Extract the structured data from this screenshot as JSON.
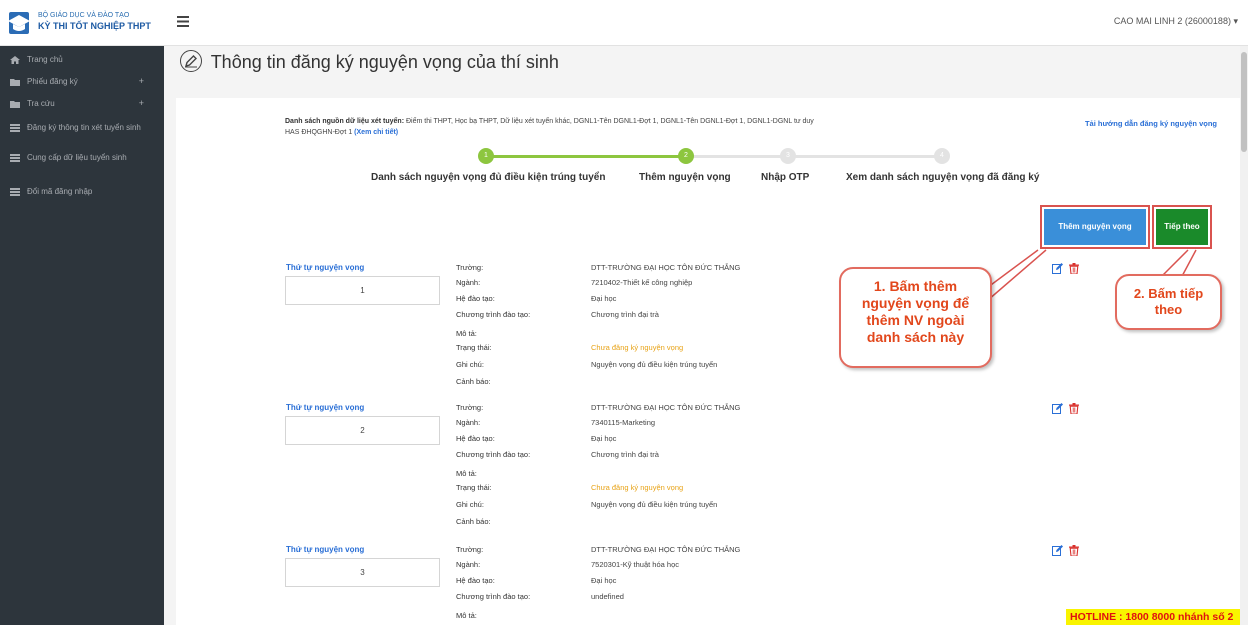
{
  "logo": {
    "line1": "BỘ GIÁO DỤC VÀ ĐÀO TẠO",
    "line2": "KỲ THI TỐT NGHIỆP THPT"
  },
  "sidebar": {
    "items": [
      {
        "label": "Trang chủ",
        "icon": "home-icon"
      },
      {
        "label": "Phiếu đăng ký",
        "icon": "folder-icon",
        "plus": "+"
      },
      {
        "label": "Tra cứu",
        "icon": "folder-icon",
        "plus": "+"
      },
      {
        "label": "Đăng ký thông tin xét tuyển sinh",
        "icon": "list-icon"
      },
      {
        "label": "Cung cấp dữ liệu tuyển sinh",
        "icon": "list-icon"
      },
      {
        "label": "Đổi mã đăng nhập",
        "icon": "list-icon"
      }
    ]
  },
  "topbar": {
    "user": "CAO MAI LINH 2 (26000188)",
    "user_caret": "▾"
  },
  "page": {
    "title": "Thông tin đăng ký nguyện vọng của thí sinh"
  },
  "sources": {
    "label": "Danh sách nguồn dữ liệu xét tuyển:",
    "text": " Điểm thi THPT, Học bạ THPT, Dữ liệu xét tuyển khác, DGNL1-Tên DGNL1-Đợt 1, DGNL1-Tên DGNL1-Đợt 1, DGNL1-DGNL tư duy HAS ĐHQGHN-Đợt 1",
    "link": "(Xem chi tiết)"
  },
  "guide_link": "Tải hướng dẫn đăng ký nguyện vọng",
  "stepper": {
    "steps": [
      {
        "num": "1",
        "label": "Danh sách nguyện vọng đủ điều kiện trúng tuyển"
      },
      {
        "num": "2",
        "label": "Thêm nguyện vọng"
      },
      {
        "num": "3",
        "label": "Nhập OTP"
      },
      {
        "num": "4",
        "label": "Xem danh sách nguyện vọng đã đăng ký"
      }
    ]
  },
  "buttons": {
    "add": "Thêm nguyện vọng",
    "next": "Tiếp theo"
  },
  "labels": {
    "order": "Thứ tự nguyện vọng",
    "school": "Trường:",
    "major": "Ngành:",
    "training_type": "Hệ đào tạo:",
    "program": "Chương trình đào tạo:",
    "desc": "Mô tả:",
    "status": "Trạng thái:",
    "note": "Ghi chú:",
    "warning": "Cảnh báo:"
  },
  "entries": [
    {
      "order": "1",
      "school": "DTT-TRƯỜNG ĐẠI HỌC TÔN ĐỨC THẮNG",
      "major": "7210402-Thiết kế công nghiệp",
      "training_type": "Đại học",
      "program": "Chương trình đại trà",
      "status": "Chưa đăng ký nguyện vọng",
      "note": "Nguyện vọng đủ điều kiện trúng tuyển"
    },
    {
      "order": "2",
      "school": "DTT-TRƯỜNG ĐẠI HỌC TÔN ĐỨC THẮNG",
      "major": "7340115-Marketing",
      "training_type": "Đại học",
      "program": "Chương trình đại trà",
      "status": "Chưa đăng ký nguyện vọng",
      "note": "Nguyện vọng đủ điều kiện trúng tuyển"
    },
    {
      "order": "3",
      "school": "DTT-TRƯỜNG ĐẠI HỌC TÔN ĐỨC THẮNG",
      "major": "7520301-Kỹ thuật hóa học",
      "training_type": "Đại học",
      "program": "undefined"
    }
  ],
  "callouts": {
    "c1": [
      "1. Bấm thêm",
      "nguyện vọng để",
      "thêm NV ngoài",
      "danh sách này"
    ],
    "c2": [
      "2. Bấm tiếp",
      "theo"
    ]
  },
  "hotline": "HOTLINE : 1800 8000 nhánh số 2",
  "colors": {
    "sidebar": "#2d353c",
    "accent_green": "#8dc63f",
    "link": "#2a6fd6",
    "warning": "#e8a317",
    "callout": "#e2471c",
    "hotline_bg": "#f9f400"
  }
}
